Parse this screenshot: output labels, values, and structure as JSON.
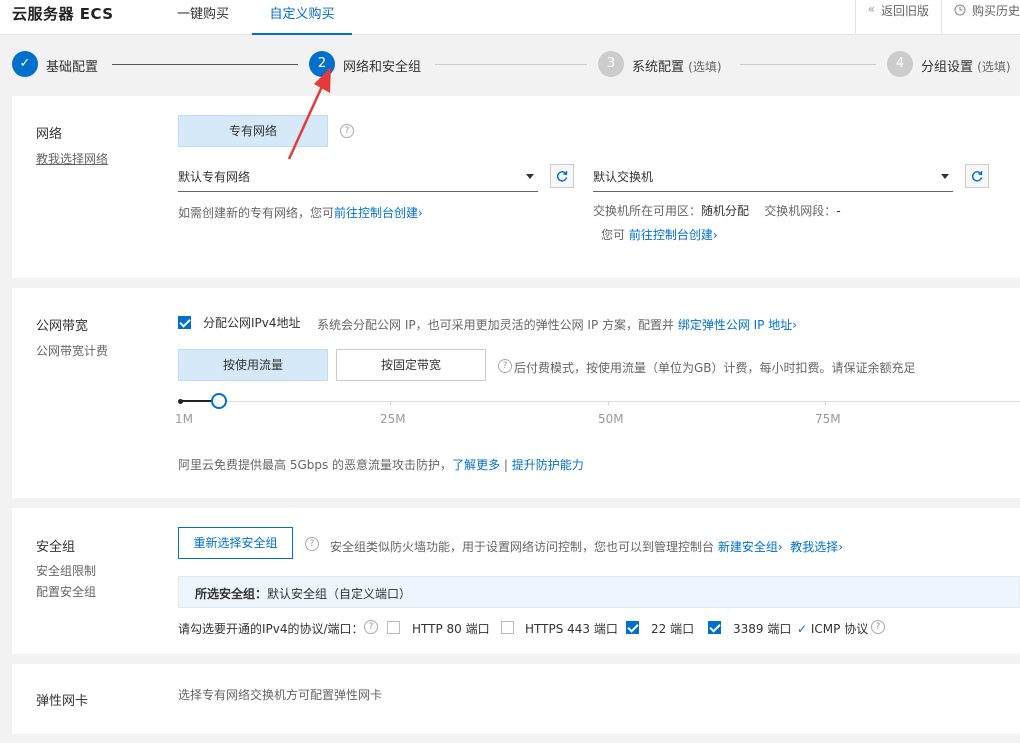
{
  "header": {
    "brand": "云服务器 ECS",
    "tabs": [
      "一键购买",
      "自定义购买"
    ],
    "back_old": "返回旧版",
    "history": "购买历史"
  },
  "steps": [
    {
      "num": "✓",
      "label": "基础配置",
      "optional": ""
    },
    {
      "num": "2",
      "label": "网络和安全组",
      "optional": ""
    },
    {
      "num": "3",
      "label": "系统配置",
      "optional": "(选填)"
    },
    {
      "num": "4",
      "label": "分组设置",
      "optional": "(选填)"
    }
  ],
  "network": {
    "title": "网络",
    "sub_link": "教我选择网络",
    "type_button": "专有网络",
    "vpc_select": "默认专有网络",
    "vswitch_select": "默认交换机",
    "vpc_note_prefix": "如需创建新的专有网络，您可",
    "vpc_note_link": "前往控制台创建›",
    "zone_label": "交换机所在可用区：",
    "zone_value": "随机分配",
    "cidr_label": "交换机网段：",
    "cidr_value": "-",
    "vswitch_note_prefix": "您可",
    "vswitch_note_link": "前往控制台创建›"
  },
  "bandwidth": {
    "title": "公网带宽",
    "sub": "公网带宽计费",
    "assign_label": "分配公网IPv4地址",
    "assign_checked": true,
    "assign_note": "系统会分配公网 IP，也可采用更加灵活的弹性公网 IP 方案，配置并",
    "assign_link": "绑定弹性公网 IP 地址›",
    "billing_options": [
      "按使用流量",
      "按固定带宽"
    ],
    "billing_note": "后付费模式，按使用流量（单位为GB）计费，每小时扣费。请保证余额充足",
    "slider_ticks": [
      "1M",
      "25M",
      "50M",
      "75M"
    ],
    "slider_value_mbps": 1,
    "ddos_note": "阿里云免费提供最高 5Gbps 的恶意流量攻击防护，",
    "ddos_link1": "了解更多",
    "ddos_sep": "|",
    "ddos_link2": "提升防护能力"
  },
  "security_group": {
    "title": "安全组",
    "sub1": "安全组限制",
    "sub2": "配置安全组",
    "reselect_button": "重新选择安全组",
    "note": "安全组类似防火墙功能，用于设置网络访问控制，您也可以到管理控制台",
    "link_new": "新建安全组›",
    "link_help": "教我选择›",
    "selected_label": "所选安全组：",
    "selected_value": "默认安全组（自定义端口）",
    "ports_label": "请勾选要开通的IPv4的协议/端口：",
    "ports": [
      {
        "label": "HTTP 80 端口",
        "checked": false
      },
      {
        "label": "HTTPS 443 端口",
        "checked": false
      },
      {
        "label": "22 端口",
        "checked": true
      },
      {
        "label": "3389 端口",
        "checked": true
      }
    ],
    "icmp_label": "ICMP 协议"
  },
  "eni": {
    "title": "弹性网卡",
    "note": "选择专有网络交换机方可配置弹性网卡"
  },
  "colors": {
    "accent": "#0070cc",
    "arrow": "#e8393a"
  }
}
